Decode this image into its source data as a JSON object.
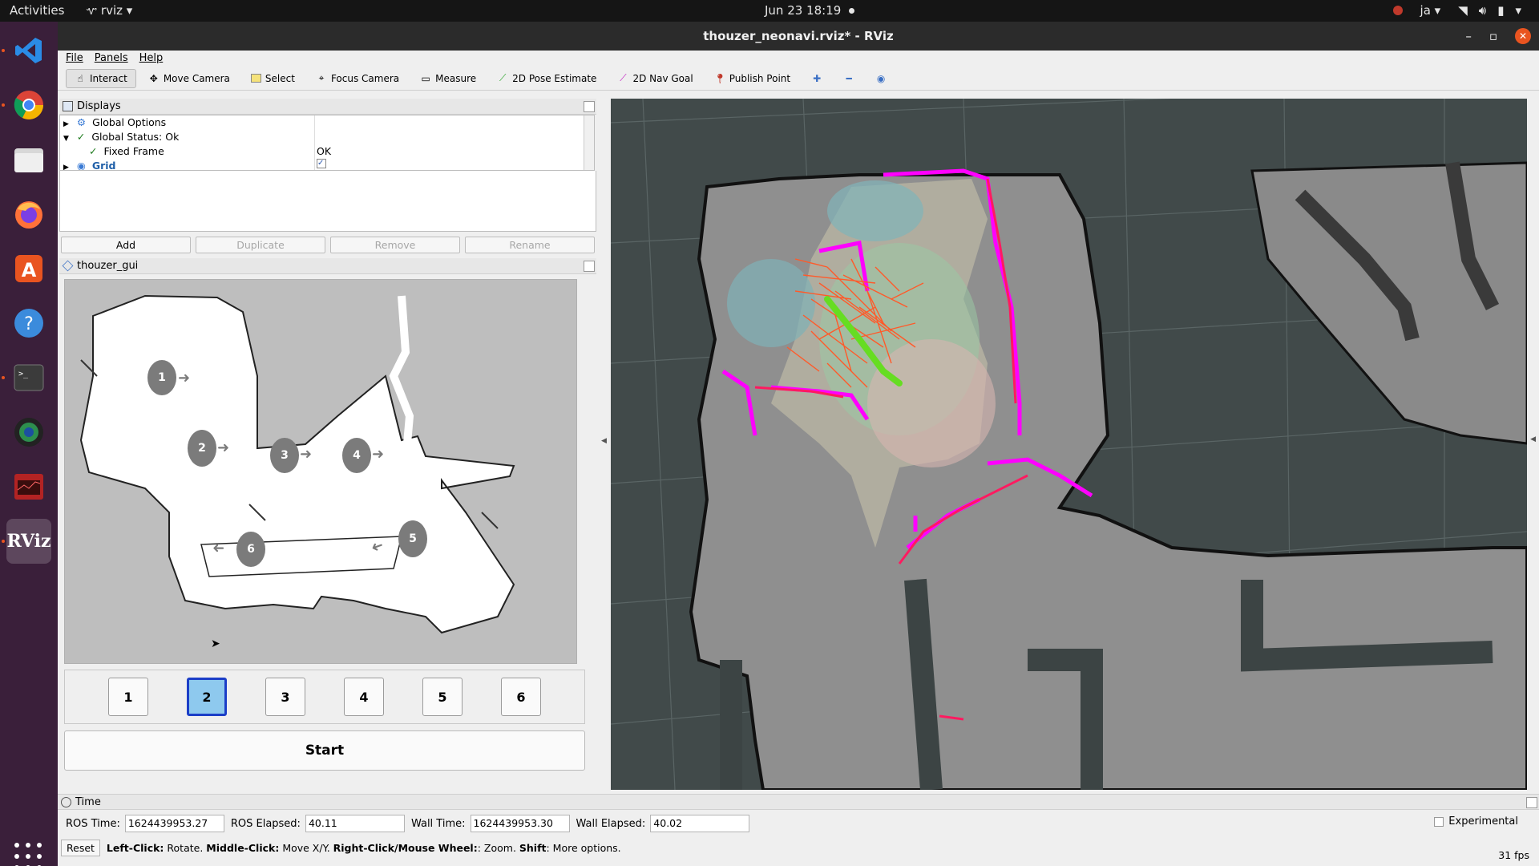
{
  "topbar": {
    "activities": "Activities",
    "app_name": "rviz",
    "clock": "Jun 23  18:19",
    "input_method": "ja"
  },
  "dock": {
    "items": [
      "vscode-icon",
      "chrome-icon",
      "files-icon",
      "firefox-icon",
      "software-center-icon",
      "help-icon",
      "terminal-icon",
      "camera-app-icon",
      "system-monitor-icon",
      "rviz-icon"
    ],
    "rviz_label": "RViz"
  },
  "window": {
    "title": "thouzer_neonavi.rviz* - RViz"
  },
  "menu": {
    "file": "File",
    "panels": "Panels",
    "help": "Help"
  },
  "toolbar": {
    "interact": "Interact",
    "move_camera": "Move Camera",
    "select": "Select",
    "focus_camera": "Focus Camera",
    "measure": "Measure",
    "pose_estimate": "2D Pose Estimate",
    "nav_goal": "2D Nav Goal",
    "publish_point": "Publish Point"
  },
  "displays": {
    "title": "Displays",
    "rows": [
      {
        "label": "Global Options",
        "value": ""
      },
      {
        "label": "Global Status: Ok",
        "value": ""
      },
      {
        "label": "Fixed Frame",
        "value": "OK"
      },
      {
        "label": "Grid",
        "value": ""
      }
    ],
    "buttons": {
      "add": "Add",
      "duplicate": "Duplicate",
      "remove": "Remove",
      "rename": "Rename"
    }
  },
  "gui_panel": {
    "title": "thouzer_gui",
    "map_markers": [
      "1",
      "2",
      "3",
      "4",
      "5",
      "6"
    ],
    "waypoints": [
      "1",
      "2",
      "3",
      "4",
      "5",
      "6"
    ],
    "selected_waypoint": "2",
    "start": "Start"
  },
  "time_panel": {
    "title": "Time",
    "ros_time_label": "ROS Time:",
    "ros_time": "1624439953.27",
    "ros_elapsed_label": "ROS Elapsed:",
    "ros_elapsed": "40.11",
    "wall_time_label": "Wall Time:",
    "wall_time": "1624439953.30",
    "wall_elapsed_label": "Wall Elapsed:",
    "wall_elapsed": "40.02",
    "experimental": "Experimental"
  },
  "status": {
    "reset": "Reset",
    "left_click": "Left-Click:",
    "left_click_text": " Rotate. ",
    "middle_click": "Middle-Click:",
    "middle_click_text": " Move X/Y. ",
    "right_click": "Right-Click/Mouse Wheel:",
    "right_click_text": ": Zoom. ",
    "shift": "Shift",
    "shift_text": ": More options.",
    "fps": "31 fps"
  },
  "colors": {
    "accent_orange": "#e95420",
    "selected_blue": "#1b3ec7",
    "selected_fill": "#8ec9ee",
    "map_magenta": "#ff00ff",
    "path_green": "#66dd22"
  }
}
